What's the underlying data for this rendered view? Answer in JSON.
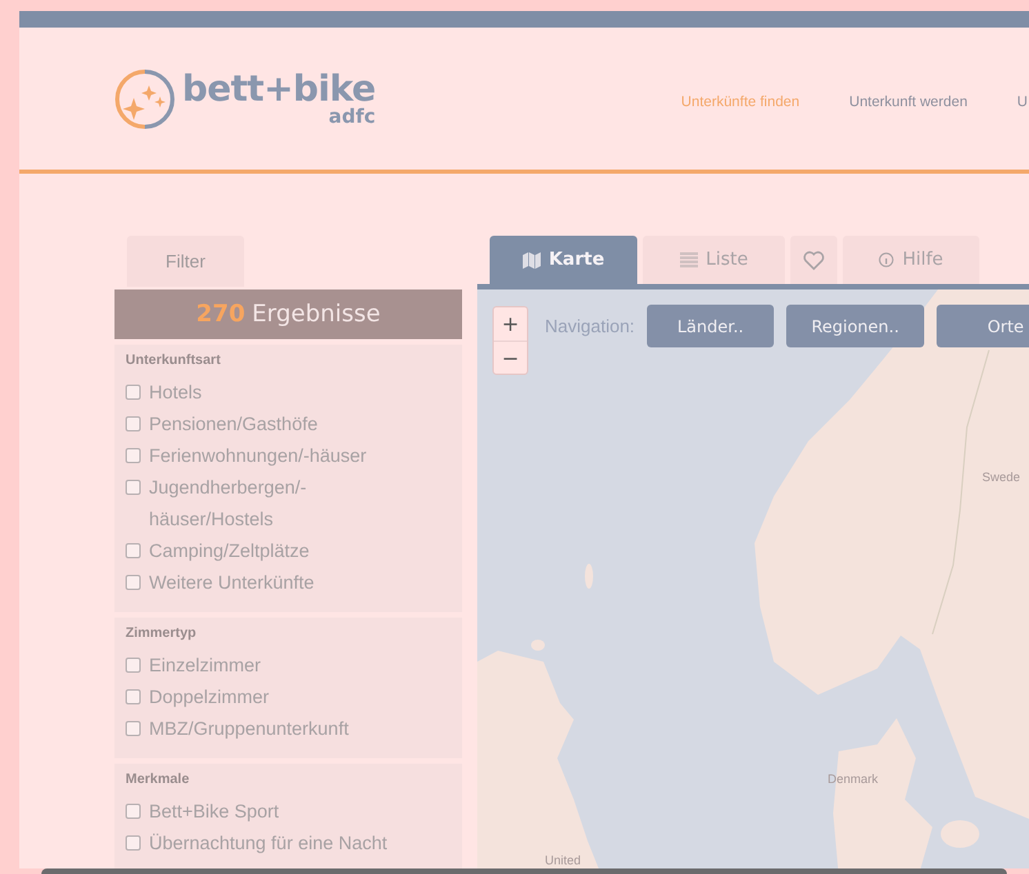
{
  "logo": {
    "name": "bett+bike",
    "sub": "adfc"
  },
  "nav": [
    {
      "label": "Unterkünfte finden",
      "selected": true
    },
    {
      "label": "Unterkunft werden",
      "selected": false
    },
    {
      "label": "U",
      "selected": false
    }
  ],
  "filter_tab": "Filter",
  "results": {
    "count": "270",
    "label": "Ergebnisse"
  },
  "filter_sections": [
    {
      "title": "Unterkunftsart",
      "options": [
        {
          "label": "Hotels",
          "checked": false
        },
        {
          "label": "Pensionen/Gasthöfe",
          "checked": false
        },
        {
          "label": "Ferienwohnungen/-häuser",
          "checked": false
        },
        {
          "label": "Jugendherbergen/-häuser/Hostels",
          "checked": false
        },
        {
          "label": "Camping/Zeltplätze",
          "checked": false
        },
        {
          "label": "Weitere Unterkünfte",
          "checked": false
        }
      ]
    },
    {
      "title": "Zimmertyp",
      "options": [
        {
          "label": "Einzelzimmer",
          "checked": false
        },
        {
          "label": "Doppelzimmer",
          "checked": false
        },
        {
          "label": "MBZ/Gruppenunterkunft",
          "checked": false
        }
      ]
    },
    {
      "title": "Merkmale",
      "options": [
        {
          "label": "Bett+Bike Sport",
          "checked": false
        },
        {
          "label": "Übernachtung für eine Nacht",
          "checked": false
        }
      ]
    }
  ],
  "view_tabs": [
    {
      "kind": "map",
      "label": "Karte",
      "selected": true
    },
    {
      "kind": "list",
      "label": "Liste",
      "selected": false
    },
    {
      "kind": "favorites",
      "selected": false
    },
    {
      "kind": "help",
      "label": "Hilfe",
      "selected": false
    }
  ],
  "map": {
    "zoom_in": "+",
    "zoom_out": "−",
    "navigation_label": "Navigation:",
    "navigation_buttons": [
      "Länder..",
      "Regionen..",
      "Orte"
    ],
    "labels": [
      {
        "kind": "sweden",
        "text": "Swede"
      },
      {
        "kind": "denmark",
        "text": "Denmark"
      },
      {
        "kind": "uk",
        "text": "United"
      }
    ]
  }
}
